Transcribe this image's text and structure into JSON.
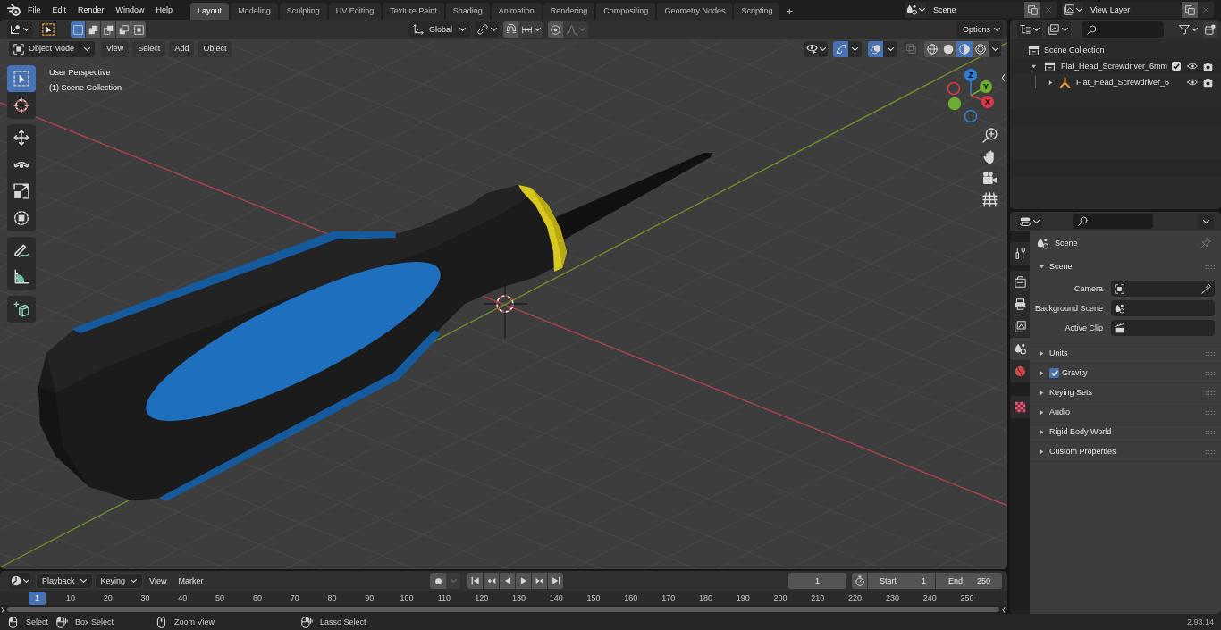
{
  "topbar": {
    "menus": [
      "File",
      "Edit",
      "Render",
      "Window",
      "Help"
    ],
    "workspaces": [
      {
        "label": "Layout",
        "selected": true
      },
      {
        "label": "Modeling",
        "selected": false
      },
      {
        "label": "Sculpting",
        "selected": false
      },
      {
        "label": "UV Editing",
        "selected": false
      },
      {
        "label": "Texture Paint",
        "selected": false
      },
      {
        "label": "Shading",
        "selected": false
      },
      {
        "label": "Animation",
        "selected": false
      },
      {
        "label": "Rendering",
        "selected": false
      },
      {
        "label": "Compositing",
        "selected": false
      },
      {
        "label": "Geometry Nodes",
        "selected": false
      },
      {
        "label": "Scripting",
        "selected": false
      }
    ],
    "add_workspace": "+",
    "scene": "Scene",
    "view_layer": "View Layer"
  },
  "viewport": {
    "tool_settings": {
      "select_modes": [
        {
          "kind": "set",
          "selected": true
        },
        {
          "kind": "extend",
          "selected": false
        },
        {
          "kind": "subtract",
          "selected": false
        },
        {
          "kind": "difference",
          "selected": false
        },
        {
          "kind": "intersect",
          "selected": false
        }
      ],
      "orientation": "Global",
      "snap": {
        "on": false
      },
      "proportional_editing": {
        "on": false
      },
      "options": "Options"
    },
    "header": {
      "mode": "Object Mode",
      "menus": [
        "View",
        "Select",
        "Add",
        "Object"
      ],
      "gizmos": {
        "on": true
      },
      "overlays": {
        "on": true
      },
      "xray": {
        "on": false
      },
      "shading": [
        {
          "kind": "wireframe",
          "selected": false
        },
        {
          "kind": "solid",
          "selected": false
        },
        {
          "kind": "material",
          "selected": true
        },
        {
          "kind": "rendered",
          "selected": false
        }
      ]
    },
    "info": [
      "User Perspective",
      "(1) Scene Collection"
    ],
    "toolbar": [
      {
        "tools": [
          {
            "kind": "select_box",
            "selected": true
          },
          {
            "kind": "cursor",
            "selected": false
          }
        ]
      },
      {
        "tools": [
          {
            "kind": "move",
            "selected": false
          },
          {
            "kind": "rotate",
            "selected": false
          },
          {
            "kind": "scale",
            "selected": false
          },
          {
            "kind": "transform",
            "selected": false
          }
        ]
      },
      {
        "tools": [
          {
            "kind": "annotate",
            "selected": false
          },
          {
            "kind": "measure",
            "selected": false
          }
        ]
      },
      {
        "tools": [
          {
            "kind": "add_cube",
            "selected": false
          }
        ]
      }
    ],
    "gizmo_axes": [
      {
        "label": "Z",
        "color": "#2e7fd8"
      },
      {
        "label": "Y",
        "color": "#6cae2f"
      },
      {
        "label": "X",
        "color": "#d8374a"
      }
    ]
  },
  "outliner": {
    "tree": [
      {
        "kind": "scene_collection",
        "label": "Scene Collection",
        "children": [
          {
            "kind": "collection",
            "label": "Flat_Head_Screwdriver_6mm",
            "expanded": true,
            "checked": true,
            "children": [
              {
                "kind": "object",
                "label": "Flat_Head_Screwdriver_6",
                "expanded": false
              }
            ]
          }
        ]
      }
    ]
  },
  "properties": {
    "tab_groups": [
      {
        "tabs": [
          {
            "kind": "tool",
            "selected": false
          }
        ]
      },
      {
        "tabs": [
          {
            "kind": "render",
            "selected": false
          },
          {
            "kind": "output",
            "selected": false
          },
          {
            "kind": "view_layer",
            "selected": false
          },
          {
            "kind": "scene",
            "selected": true
          },
          {
            "kind": "world",
            "selected": false
          }
        ]
      },
      {
        "tabs": [
          {
            "kind": "texture",
            "selected": false
          }
        ]
      }
    ],
    "context": "Scene",
    "panels": [
      {
        "title": "Scene",
        "expanded": true,
        "fields": [
          {
            "label": "Camera",
            "kind": "camera"
          },
          {
            "label": "Background Scene",
            "kind": "scene"
          },
          {
            "label": "Active Clip",
            "kind": "clip"
          }
        ]
      },
      {
        "title": "Units",
        "expanded": false
      },
      {
        "title": "Gravity",
        "expanded": false,
        "checkbox": {
          "checked": true
        }
      },
      {
        "title": "Keying Sets",
        "expanded": false
      },
      {
        "title": "Audio",
        "expanded": false
      },
      {
        "title": "Rigid Body World",
        "expanded": false
      },
      {
        "title": "Custom Properties",
        "expanded": false
      }
    ]
  },
  "timeline": {
    "dropdowns": [
      "Playback",
      "Keying"
    ],
    "menus": [
      "View",
      "Marker"
    ],
    "auto_keying": {
      "on": false
    },
    "current_frame": "1",
    "start": {
      "label": "Start",
      "value": "1"
    },
    "end": {
      "label": "End",
      "value": "250"
    },
    "playhead": "1",
    "ruler": [
      "10",
      "20",
      "30",
      "40",
      "50",
      "60",
      "70",
      "80",
      "90",
      "100",
      "110",
      "120",
      "130",
      "140",
      "150",
      "160",
      "170",
      "180",
      "190",
      "200",
      "210",
      "220",
      "230",
      "240",
      "250"
    ]
  },
  "status_bar": {
    "hints": [
      {
        "kind": "left_click",
        "label": "Select"
      },
      {
        "kind": "left_drag",
        "label": "Box Select"
      },
      {
        "kind": "middle_drag",
        "label": "Zoom View"
      },
      {
        "kind": "right_drag",
        "label": "Lasso Select"
      }
    ],
    "version": "2.93.14"
  }
}
